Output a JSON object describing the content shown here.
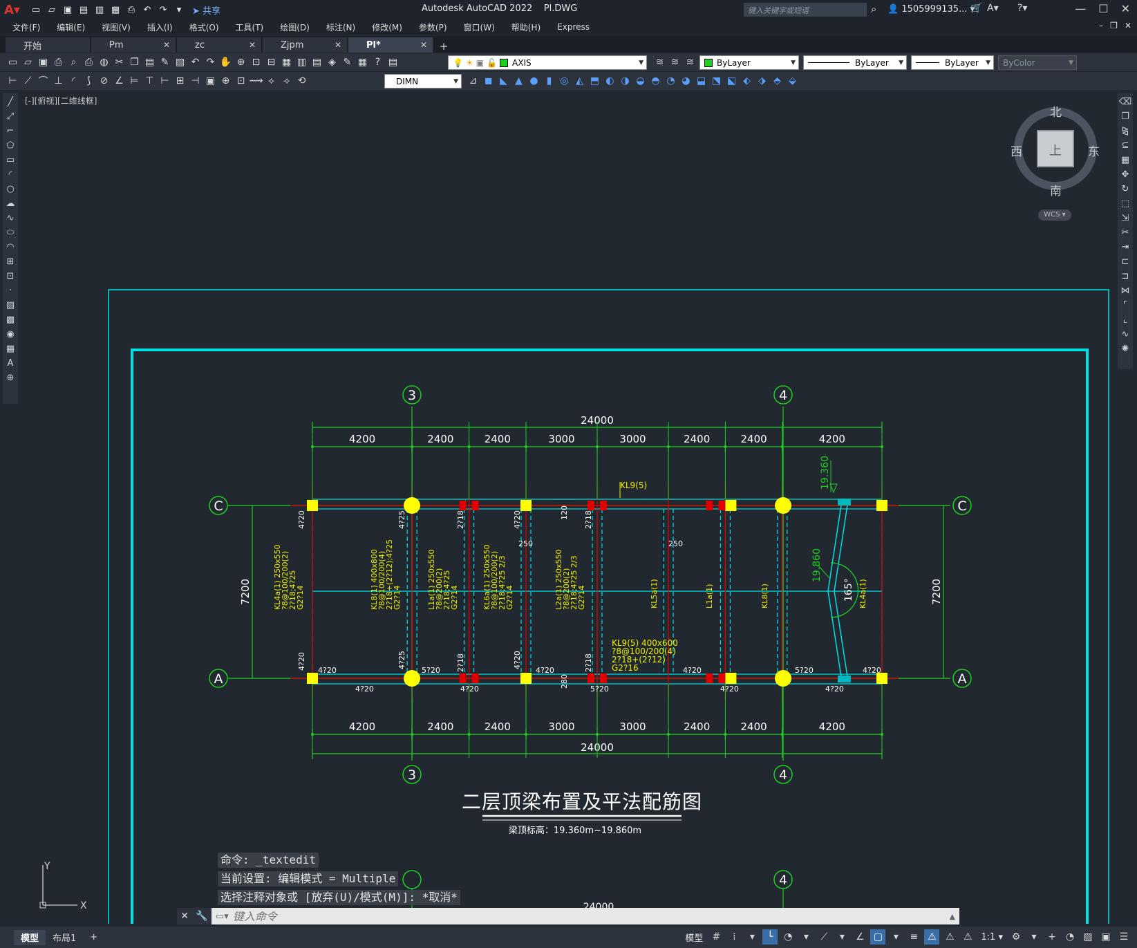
{
  "titlebar": {
    "app_title": "Autodesk AutoCAD 2022    Pl.DWG",
    "share_label": "共享",
    "search_placeholder": "键入关键字或短语",
    "user": "1505999135... ▾",
    "window_controls": [
      "—",
      "☐",
      "✕"
    ]
  },
  "menubar": {
    "items": [
      "文件(F)",
      "编辑(E)",
      "视图(V)",
      "插入(I)",
      "格式(O)",
      "工具(T)",
      "绘图(D)",
      "标注(N)",
      "修改(M)",
      "参数(P)",
      "窗口(W)",
      "帮助(H)",
      "Express"
    ]
  },
  "tabs": [
    {
      "label": "开始"
    },
    {
      "label": "Pm"
    },
    {
      "label": "zc"
    },
    {
      "label": "Zjpm"
    },
    {
      "label": "Pl*"
    }
  ],
  "toolbar1": {
    "layer": "AXIS",
    "color": "ByLayer",
    "linetype": "ByLayer",
    "lineweight": "ByLayer",
    "plotstyle": "ByColor"
  },
  "toolbar2": {
    "dimstyle": "DIMN"
  },
  "viewport": {
    "label": "[-][俯视][二维线框]"
  },
  "viewcube": {
    "north": "北",
    "south": "南",
    "east": "东",
    "west": "西",
    "face": "上",
    "wcs": "WCS ▾"
  },
  "ucs": {
    "x": "X",
    "y": "Y"
  },
  "drawing": {
    "title": "二层顶梁布置及平法配筋图",
    "subtitle": "梁顶标高：19.360m~19.860m",
    "grid_labels": {
      "g3": "3",
      "g4": "4",
      "gC": "C",
      "gA": "A"
    },
    "total_dim": "24000",
    "spans": [
      "4200",
      "2400",
      "2400",
      "3000",
      "3000",
      "2400",
      "2400",
      "4200"
    ],
    "side_dim": "7200",
    "elev_top": "19.360",
    "elev_mid": "19.860",
    "angle": "165°",
    "beam_top_label": "KL9(5)",
    "beam_bottom_label": [
      "KL9(5) 400x600",
      "?8@100/200(4)",
      "2?18+(2?12)",
      "G2?16"
    ],
    "v_labels": [
      [
        "KL4a(1) 250x550",
        "?8@100/200(2)",
        "2?18;4?25",
        "G2?14"
      ],
      [
        "KL8(1) 400x800",
        "?8@100/200(4)",
        "2?18+(2?12);4?25",
        "G2?14"
      ],
      [
        "L1a(1) 250x550",
        "?8@200(2)",
        "2?18;4?25",
        "G2?14"
      ],
      [
        "KL6a(1) 250x550",
        "?8@100/200(2)",
        "2?18;4?25 2/3",
        "G2?14"
      ],
      [
        "L2a(1) 250x550",
        "?8@200(2)",
        "2?18;4?25 2/3",
        "G2?14"
      ]
    ],
    "short_v_labels": [
      "KL5a(1)",
      "L1a(1)",
      "KL8(1)",
      "KL4a(1)"
    ],
    "rebar_texts": {
      "r4_20": "4?20",
      "r4_25": "4?25",
      "r2_18": "2?18",
      "r5_20": "5?20",
      "r120": "120",
      "r280": "280",
      "r250": "250"
    },
    "next_sheet_dim": "24000",
    "next_spans": [
      "4200",
      "2400",
      "2400",
      "3000",
      "3000",
      "2400",
      "2400",
      "4200"
    ]
  },
  "command": {
    "history": [
      "命令: _textedit",
      "当前设置: 编辑模式 = Multiple",
      "选择注释对象或 [放弃(U)/模式(M)]: *取消*"
    ],
    "placeholder": "键入命令"
  },
  "statusbar": {
    "layout_tabs": [
      "模型",
      "布局1"
    ],
    "model_label": "模型",
    "scale": "1:1 ▾"
  },
  "colors": {
    "background": "#212830",
    "frame": "#00e1e6",
    "grid_line": "#20d020",
    "dim_text": "#ffffff",
    "annotation": "#f0f000",
    "column": "#ffff00",
    "red_column": "#e00000"
  }
}
